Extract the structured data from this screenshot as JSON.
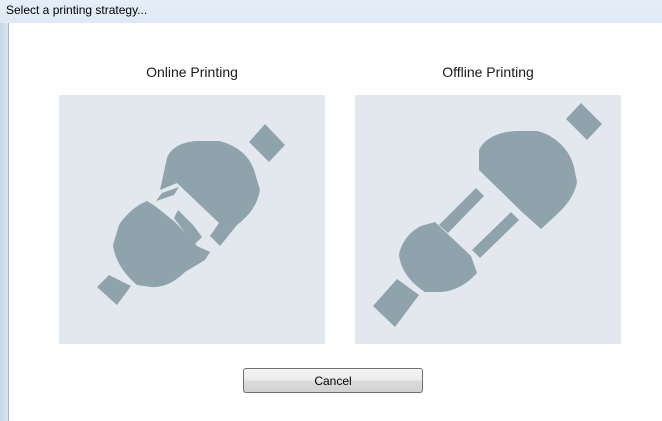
{
  "window": {
    "title": "Select a printing strategy..."
  },
  "options": [
    {
      "label": "Online Printing",
      "icon": "plug-connected-icon"
    },
    {
      "label": "Offline Printing",
      "icon": "plug-disconnected-icon"
    }
  ],
  "cancel_label": "Cancel",
  "colors": {
    "image_background": "#e2e8ee",
    "plug": "#8fa3ad",
    "titlebar": "#dbe6f3"
  }
}
